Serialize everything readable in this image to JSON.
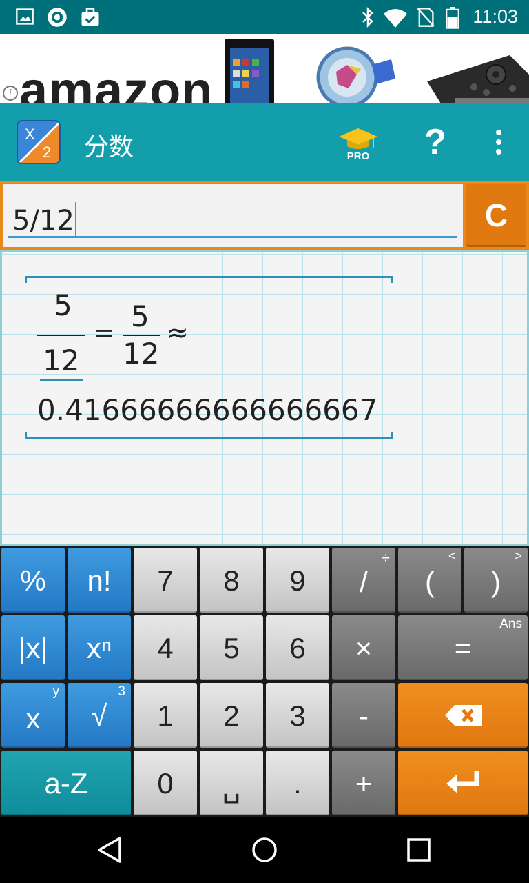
{
  "status_bar": {
    "time": "11:03",
    "left_icons": [
      "image-icon",
      "app-circle-icon",
      "briefcase-check-icon"
    ],
    "right_icons": [
      "bluetooth-icon",
      "wifi-icon",
      "no-sim-icon",
      "battery-icon"
    ]
  },
  "ad": {
    "text": "amazon",
    "info_icon": "i"
  },
  "app_bar": {
    "title": "分数",
    "pro_label": "PRO",
    "help_label": "?",
    "bg_color": "#139eac"
  },
  "input": {
    "value": "5/12",
    "clear_label": "C"
  },
  "result": {
    "input_fraction": {
      "numerator": "5",
      "denominator": "12"
    },
    "equals": "=",
    "simplified_fraction": {
      "numerator": "5",
      "denominator": "12"
    },
    "approx": "≈",
    "decimal": "0.41666666666666667"
  },
  "keypad": {
    "row1": [
      {
        "label": "%",
        "sup": ""
      },
      {
        "label": "n!",
        "sup": ""
      },
      {
        "label": "7",
        "sup": ""
      },
      {
        "label": "8",
        "sup": ""
      },
      {
        "label": "9",
        "sup": ""
      },
      {
        "label": "/",
        "sup": "÷"
      },
      {
        "label": "(",
        "sup": "<"
      },
      {
        "label": ")",
        "sup": ">"
      }
    ],
    "row2": [
      {
        "label": "|x|",
        "sup": ""
      },
      {
        "label": "xⁿ",
        "sup": ""
      },
      {
        "label": "4",
        "sup": ""
      },
      {
        "label": "5",
        "sup": ""
      },
      {
        "label": "6",
        "sup": ""
      },
      {
        "label": "×",
        "sup": ""
      },
      {
        "label": "=",
        "sup": "Ans"
      }
    ],
    "row3": [
      {
        "label": "x",
        "sup": "y"
      },
      {
        "label": "√",
        "sup": "3"
      },
      {
        "label": "1",
        "sup": ""
      },
      {
        "label": "2",
        "sup": ""
      },
      {
        "label": "3",
        "sup": ""
      },
      {
        "label": "-",
        "sup": ""
      },
      {
        "label": "backspace-icon",
        "sup": ""
      }
    ],
    "row4": [
      {
        "label": "a-Z",
        "sup": ""
      },
      {
        "label": "0",
        "sup": ""
      },
      {
        "label": "␣",
        "sup": ""
      },
      {
        "label": ".",
        "sup": ""
      },
      {
        "label": "+",
        "sup": ""
      },
      {
        "label": "enter-icon",
        "sup": ""
      }
    ]
  },
  "nav_bar": {
    "icons": [
      "back-icon",
      "home-icon",
      "recents-icon"
    ]
  }
}
